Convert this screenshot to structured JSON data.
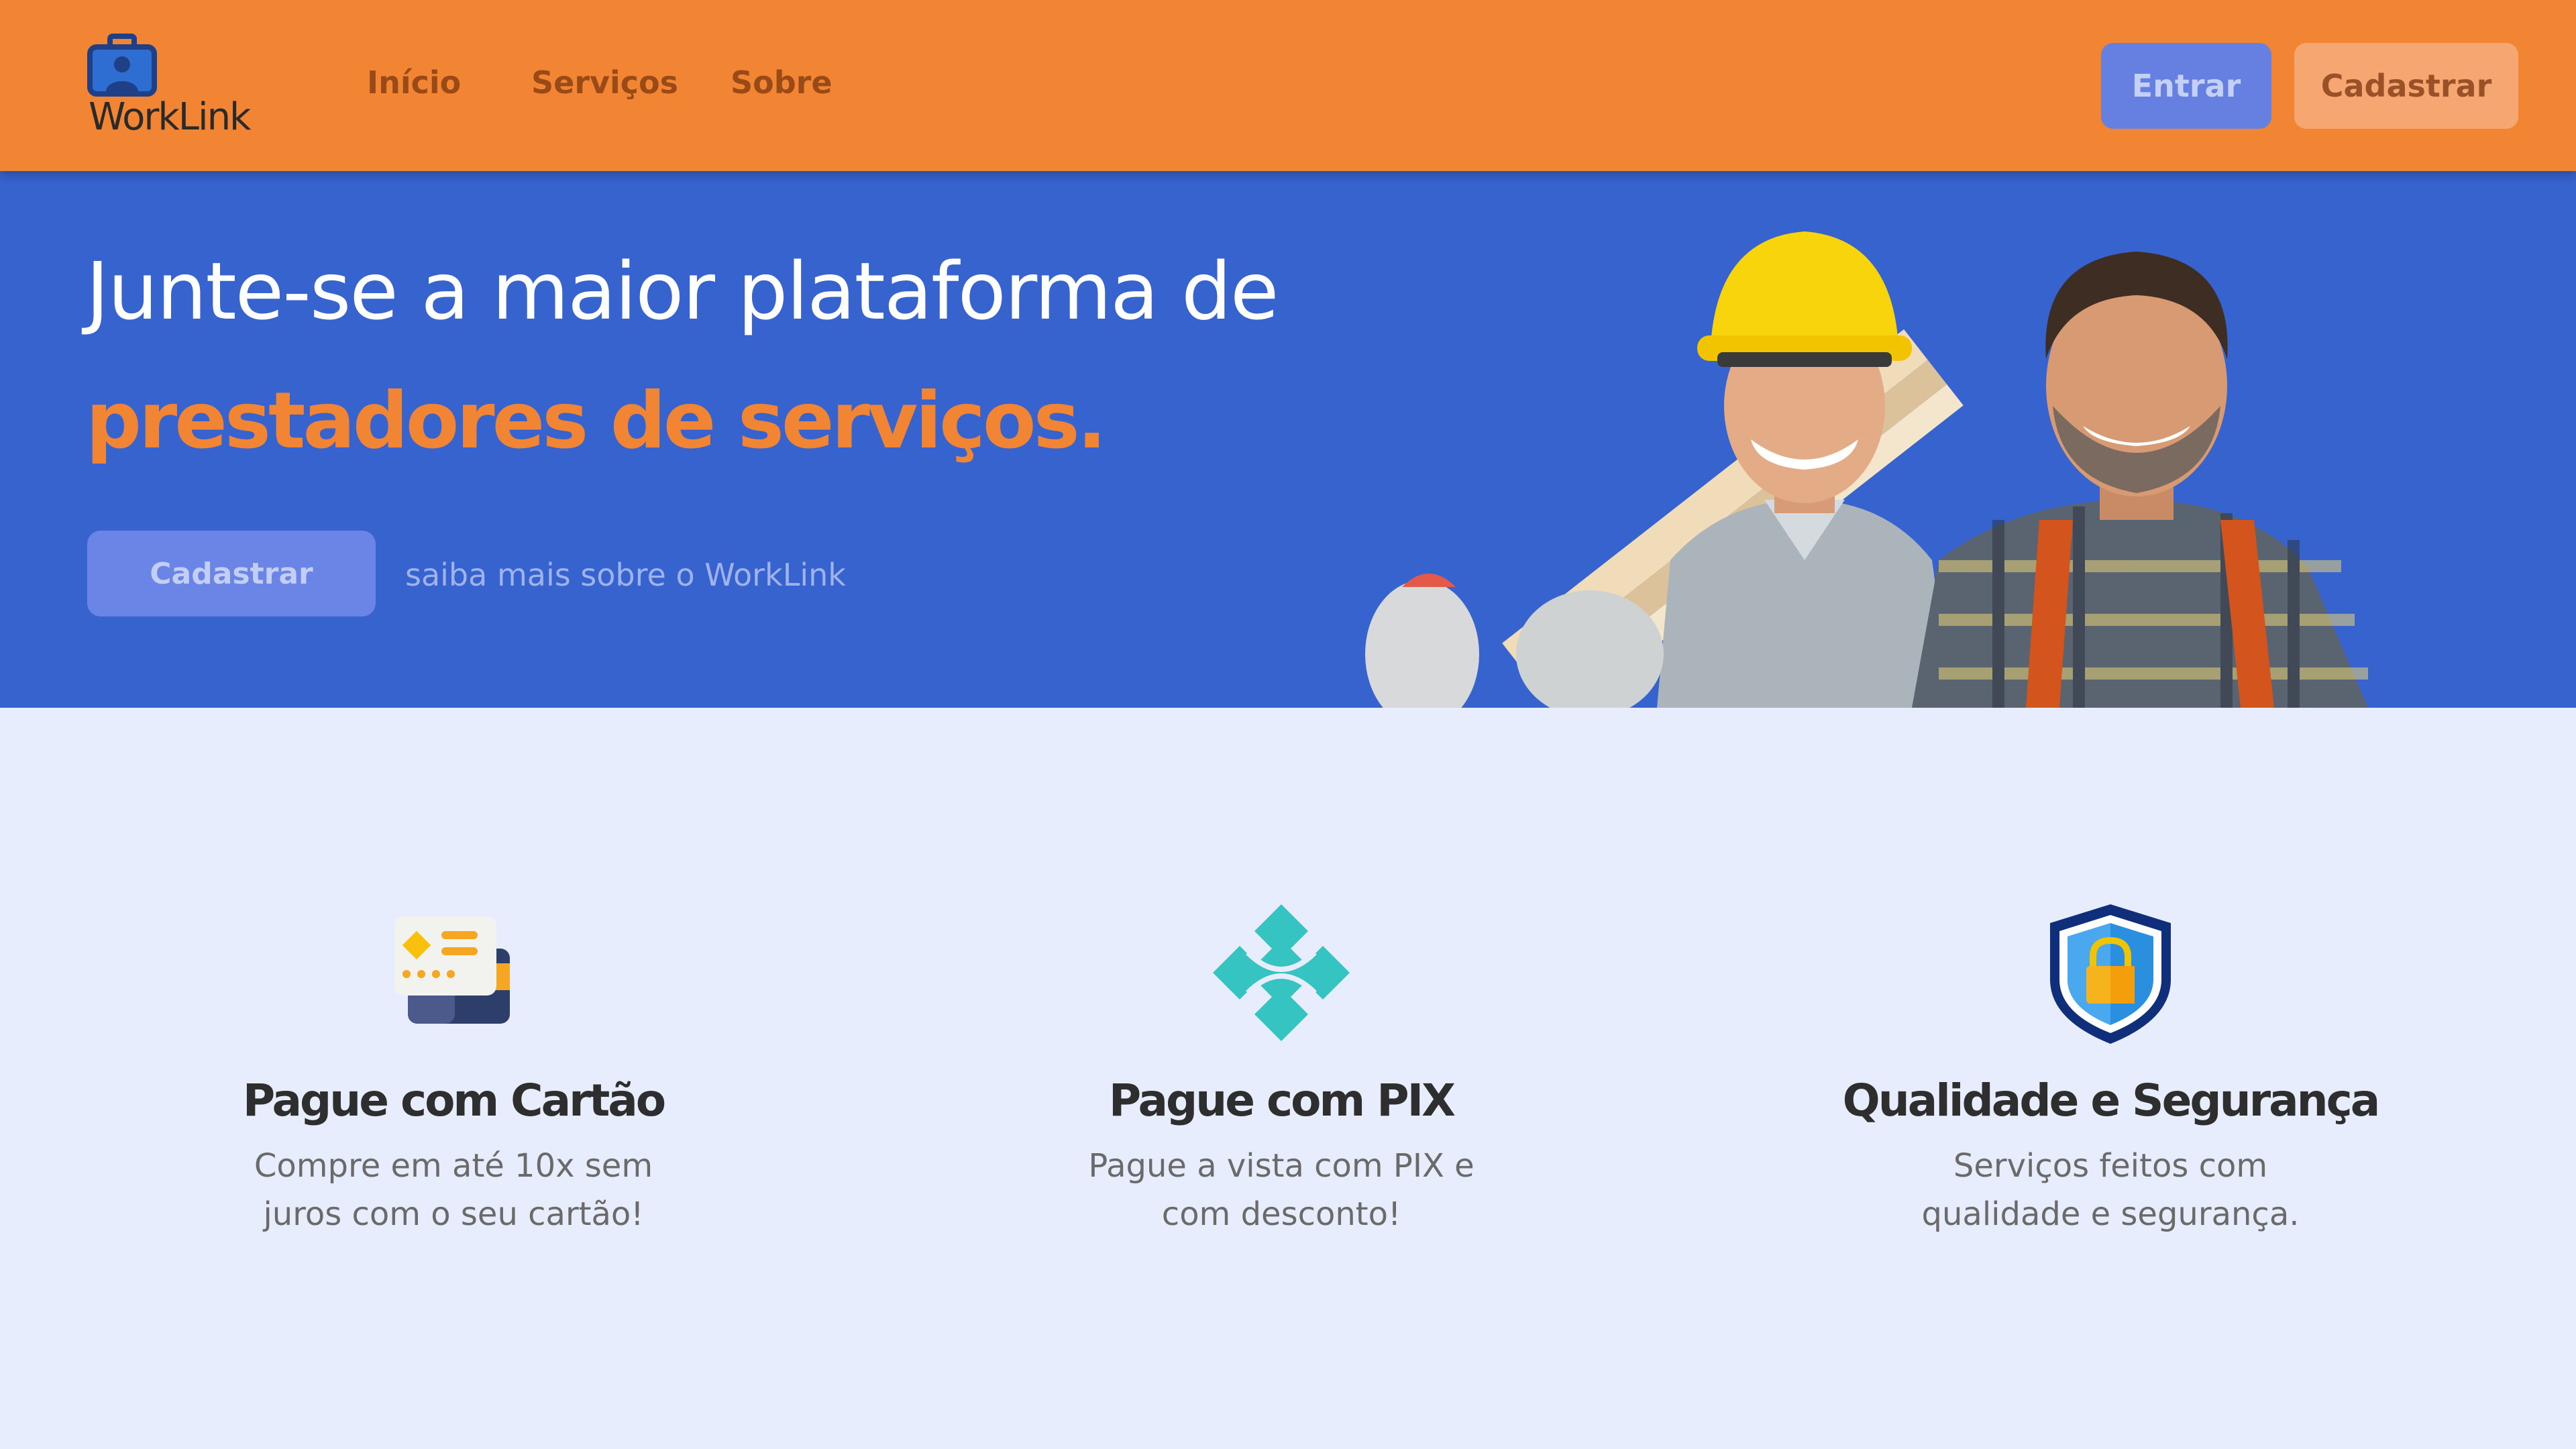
{
  "header": {
    "brand": "WorkLink",
    "nav": [
      {
        "label": "Início"
      },
      {
        "label": "Serviços"
      },
      {
        "label": "Sobre"
      }
    ],
    "login_label": "Entrar",
    "signup_label": "Cadastrar"
  },
  "hero": {
    "title_line1": "Junte-se a maior plataforma de",
    "title_line2": "prestadores de serviços.",
    "cta_label": "Cadastrar",
    "learn_more": "saiba mais sobre o WorkLink"
  },
  "features": [
    {
      "icon": "credit-card-icon",
      "title": "Pague com Cartão",
      "desc_line1": "Compre em até 10x sem",
      "desc_line2": "juros com o seu cartão!"
    },
    {
      "icon": "pix-icon",
      "title": "Pague com PIX",
      "desc_line1": "Pague a vista com PIX e",
      "desc_line2": "com desconto!"
    },
    {
      "icon": "security-shield-icon",
      "title": "Qualidade e Segurança",
      "desc_line1": "Serviços feitos com",
      "desc_line2": "qualidade e segurança."
    }
  ],
  "colors": {
    "header_bg": "#f28533",
    "hero_bg": "#3763cf",
    "accent_orange": "#f28533",
    "page_bg": "#e8edfd",
    "button_blue": "#6580e0"
  }
}
